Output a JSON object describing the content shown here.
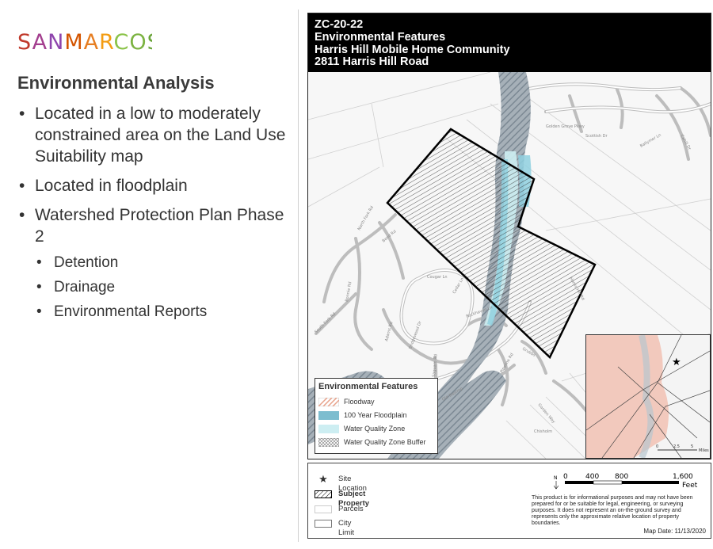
{
  "logo": {
    "text": "SANMARCOS",
    "colors": [
      "#c0392b",
      "#8e44ad",
      "#d35400",
      "#7cb342"
    ]
  },
  "slide": {
    "heading": "Environmental Analysis",
    "bullets": [
      "Located in a low to moderately constrained area on the Land Use Suitability map",
      "Located in floodplain",
      "Watershed Protection Plan Phase 2"
    ],
    "subbullets": [
      "Detention",
      "Drainage",
      "Environmental Reports"
    ]
  },
  "map": {
    "title_lines": [
      "ZC-20-22",
      "Environmental Features",
      "Harris Hill Mobile Home Community",
      "2811 Harris Hill Road"
    ],
    "street_labels": [
      "Golden Grove Pkwy",
      "Scottish Dr",
      "Ballymer Ln",
      "Cahill Dr",
      "North Fork Rd",
      "Bend Rd",
      "Bonnie Rd",
      "South Fork Rd",
      "Adams Rd",
      "Cougar Ln",
      "Cedar Ln",
      "Rockhaven Ln",
      "Bridgewood Dr",
      "Saguaro Rd",
      "Harris Hill Rd",
      "Old Bastrop",
      "Pipeline Rd",
      "Garden Way",
      "Chisholm",
      "Grubbs"
    ],
    "legend": {
      "title": "Environmental Features",
      "items": [
        {
          "label": "Floodway",
          "color": "#e8a38c"
        },
        {
          "label": "100 Year Floodplain",
          "color": "#7dbdcf"
        },
        {
          "label": "Water Quality Zone",
          "color": "#cdeef2"
        },
        {
          "label": "Water Quality Zone Buffer",
          "color": "#bbbbbb"
        }
      ]
    },
    "inset": {
      "scale_labels": [
        "0",
        "2.5",
        "5"
      ],
      "unit": "Miles"
    }
  },
  "bottom": {
    "items": [
      {
        "label": "Site Location"
      },
      {
        "label": "Subject Property"
      },
      {
        "label": "Parcels"
      },
      {
        "label": "City Limit"
      }
    ],
    "scale": {
      "ticks": [
        "0",
        "400",
        "800",
        "1,600"
      ],
      "unit": "Feet",
      "north": "N"
    },
    "disclaimer": "This product is for informational purposes and may not have been prepared for or be suitable for legal, engineering, or surveying purposes. It does not represent an on-the-ground survey and represents only the approximate relative location of property boundaries.",
    "map_date": "Map Date: 11/13/2020"
  },
  "colors": {
    "floodway_hatch": "#8a9aa6",
    "floodplain": "#8fd0df",
    "water_zone": "#d4f0f5",
    "city_limit_fill": "#f2c9bd"
  }
}
